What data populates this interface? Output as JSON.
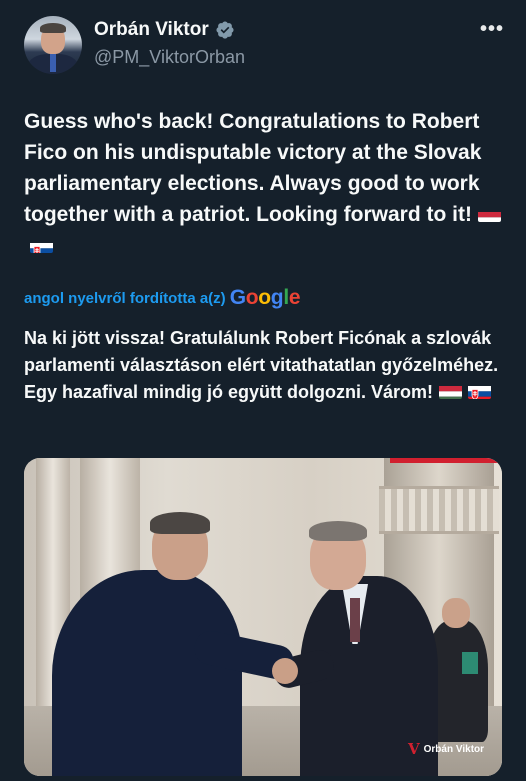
{
  "tweet": {
    "author": {
      "name": "Orbán Viktor",
      "handle": "@PM_ViktorOrban",
      "verified": true
    },
    "more_icon": "more-horizontal-icon",
    "more_label": "•••",
    "text": "Guess who's back! Congratulations to Robert Fico on his undisputable victory at the Slovak parliamentary elections. Always good to work together with a patriot. Looking forward to it!",
    "flags": [
      "hungary-flag",
      "slovakia-flag"
    ],
    "translation": {
      "label": "angol nyelvről fordította a(z)",
      "provider": "Google",
      "text": "Na ki jött vissza! Gratulálunk Robert Ficónak a szlovák parlamenti választáson elért vitathatatlan győzelméhez. Egy hazafival mindig jó együtt dolgozni. Várom!"
    },
    "media": {
      "watermark_logo": "V",
      "watermark_text": "Orbán Viktor"
    }
  },
  "colors": {
    "background": "#15202b",
    "text": "#f7f9f9",
    "secondary": "#8b98a5",
    "link": "#1d9bf0",
    "verified": "#829aab",
    "accent_red": "#d1202f"
  }
}
